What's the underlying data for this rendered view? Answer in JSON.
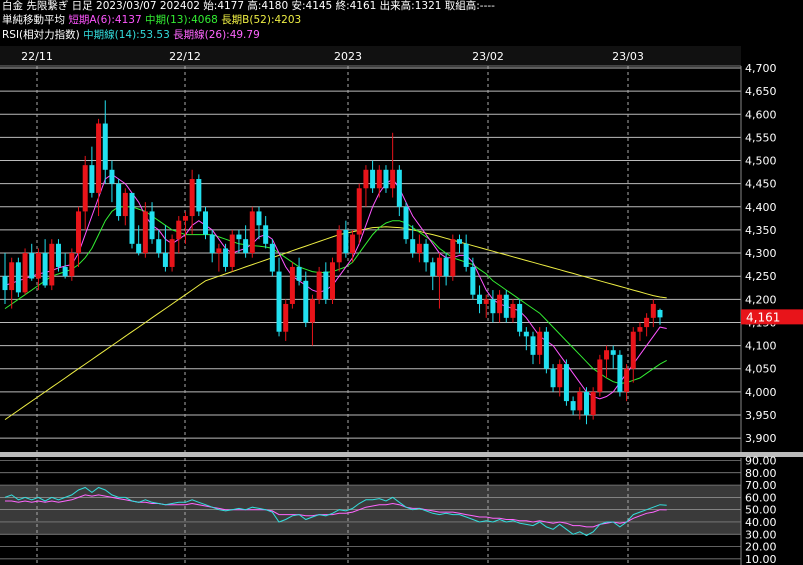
{
  "header": {
    "line1": "白金 先限繋ぎ 日足 2023/03/07 202402 始:4177 高:4180 安:4145 終:4161 出来高:1321 取組高:----",
    "ma_title": "単純移動平均",
    "ma_short": "短期A(6):4137",
    "ma_mid": "中期(13):4068",
    "ma_long": "長期B(52):4203",
    "rsi_title": "RSI(相対力指数)",
    "rsi_mid": "中期線(14):53.53",
    "rsi_long": "長期線(26):49.79"
  },
  "colors": {
    "up": "#e8141a",
    "down": "#22e0f0",
    "ma_short": "#ff55ff",
    "ma_mid": "#33ee33",
    "ma_long": "#eeee44",
    "rsi_mid": "#33dddd",
    "rsi_long": "#ff66ff",
    "price_tag": "#e8141a"
  },
  "chart_data": [
    {
      "type": "candlestick",
      "x_labels": [
        "22/11",
        "22/12",
        "2023",
        "23/02",
        "23/03"
      ],
      "y_ticks": [
        "4,700",
        "4,650",
        "4,600",
        "4,550",
        "4,500",
        "4,450",
        "4,400",
        "4,350",
        "4,300",
        "4,250",
        "4,200",
        "4,150",
        "4,100",
        "4,050",
        "4,000",
        "3,950",
        "3,900"
      ],
      "ylim": [
        3870,
        4700
      ],
      "last_price_label": "4,161",
      "last_price": 4161,
      "candles": [
        [
          4250,
          4300,
          4190,
          4220
        ],
        [
          4220,
          4290,
          4180,
          4280
        ],
        [
          4280,
          4290,
          4205,
          4215
        ],
        [
          4215,
          4310,
          4210,
          4300
        ],
        [
          4300,
          4320,
          4240,
          4245
        ],
        [
          4245,
          4310,
          4220,
          4300
        ],
        [
          4300,
          4330,
          4225,
          4230
        ],
        [
          4230,
          4330,
          4220,
          4320
        ],
        [
          4320,
          4330,
          4260,
          4270
        ],
        [
          4270,
          4300,
          4245,
          4250
        ],
        [
          4250,
          4310,
          4240,
          4300
        ],
        [
          4300,
          4400,
          4270,
          4390
        ],
        [
          4390,
          4510,
          4350,
          4490
        ],
        [
          4490,
          4530,
          4420,
          4430
        ],
        [
          4430,
          4590,
          4380,
          4580
        ],
        [
          4580,
          4630,
          4450,
          4480
        ],
        [
          4480,
          4500,
          4410,
          4450
        ],
        [
          4450,
          4460,
          4370,
          4380
        ],
        [
          4380,
          4440,
          4360,
          4430
        ],
        [
          4430,
          4430,
          4310,
          4320
        ],
        [
          4320,
          4360,
          4295,
          4300
        ],
        [
          4300,
          4410,
          4290,
          4390
        ],
        [
          4390,
          4410,
          4320,
          4330
        ],
        [
          4330,
          4350,
          4290,
          4300
        ],
        [
          4300,
          4360,
          4260,
          4270
        ],
        [
          4270,
          4340,
          4260,
          4330
        ],
        [
          4330,
          4380,
          4300,
          4370
        ],
        [
          4370,
          4390,
          4320,
          4380
        ],
        [
          4380,
          4480,
          4340,
          4460
        ],
        [
          4460,
          4470,
          4380,
          4390
        ],
        [
          4390,
          4400,
          4330,
          4340
        ],
        [
          4340,
          4350,
          4280,
          4300
        ],
        [
          4300,
          4320,
          4260,
          4310
        ],
        [
          4310,
          4320,
          4260,
          4270
        ],
        [
          4270,
          4350,
          4260,
          4340
        ],
        [
          4340,
          4350,
          4300,
          4330
        ],
        [
          4330,
          4360,
          4290,
          4300
        ],
        [
          4300,
          4400,
          4290,
          4390
        ],
        [
          4390,
          4400,
          4330,
          4360
        ],
        [
          4360,
          4380,
          4310,
          4320
        ],
        [
          4320,
          4330,
          4250,
          4260
        ],
        [
          4260,
          4290,
          4120,
          4130
        ],
        [
          4130,
          4200,
          4110,
          4190
        ],
        [
          4190,
          4280,
          4180,
          4270
        ],
        [
          4270,
          4290,
          4230,
          4240
        ],
        [
          4240,
          4260,
          4140,
          4150
        ],
        [
          4150,
          4210,
          4100,
          4200
        ],
        [
          4200,
          4270,
          4190,
          4260
        ],
        [
          4260,
          4280,
          4190,
          4200
        ],
        [
          4200,
          4290,
          4190,
          4280
        ],
        [
          4280,
          4360,
          4260,
          4350
        ],
        [
          4350,
          4370,
          4290,
          4300
        ],
        [
          4300,
          4350,
          4280,
          4340
        ],
        [
          4340,
          4450,
          4320,
          4440
        ],
        [
          4440,
          4490,
          4400,
          4480
        ],
        [
          4480,
          4500,
          4430,
          4440
        ],
        [
          4440,
          4490,
          4420,
          4480
        ],
        [
          4480,
          4490,
          4430,
          4440
        ],
        [
          4440,
          4560,
          4420,
          4480
        ],
        [
          4480,
          4490,
          4380,
          4400
        ],
        [
          4400,
          4410,
          4320,
          4330
        ],
        [
          4330,
          4360,
          4290,
          4300
        ],
        [
          4300,
          4340,
          4280,
          4320
        ],
        [
          4320,
          4330,
          4260,
          4280
        ],
        [
          4280,
          4290,
          4220,
          4250
        ],
        [
          4250,
          4300,
          4180,
          4290
        ],
        [
          4290,
          4300,
          4230,
          4250
        ],
        [
          4250,
          4340,
          4240,
          4330
        ],
        [
          4330,
          4340,
          4300,
          4320
        ],
        [
          4320,
          4340,
          4260,
          4270
        ],
        [
          4270,
          4290,
          4200,
          4210
        ],
        [
          4210,
          4230,
          4170,
          4190
        ],
        [
          4190,
          4210,
          4160,
          4200
        ],
        [
          4200,
          4220,
          4150,
          4170
        ],
        [
          4170,
          4220,
          4150,
          4210
        ],
        [
          4210,
          4220,
          4150,
          4160
        ],
        [
          4160,
          4200,
          4150,
          4190
        ],
        [
          4190,
          4200,
          4120,
          4130
        ],
        [
          4130,
          4140,
          4090,
          4120
        ],
        [
          4120,
          4130,
          4060,
          4080
        ],
        [
          4080,
          4140,
          4060,
          4130
        ],
        [
          4130,
          4140,
          4040,
          4050
        ],
        [
          4050,
          4060,
          4000,
          4010
        ],
        [
          4010,
          4070,
          3990,
          4060
        ],
        [
          4060,
          4070,
          3970,
          3980
        ],
        [
          3980,
          3990,
          3950,
          3960
        ],
        [
          3960,
          4010,
          3940,
          4000
        ],
        [
          4000,
          4010,
          3930,
          3950
        ],
        [
          3950,
          4010,
          3940,
          4000
        ],
        [
          4000,
          4080,
          3990,
          4070
        ],
        [
          4070,
          4100,
          4030,
          4090
        ],
        [
          4090,
          4100,
          4050,
          4080
        ],
        [
          4080,
          4090,
          3990,
          4000
        ],
        [
          4000,
          4060,
          3980,
          4050
        ],
        [
          4050,
          4140,
          4020,
          4130
        ],
        [
          4130,
          4150,
          4110,
          4140
        ],
        [
          4140,
          4170,
          4120,
          4160
        ],
        [
          4160,
          4200,
          4140,
          4190
        ],
        [
          4177,
          4180,
          4145,
          4161
        ]
      ],
      "ma_short": [
        4230,
        4235,
        4240,
        4245,
        4250,
        4255,
        4258,
        4262,
        4268,
        4272,
        4275,
        4300,
        4340,
        4380,
        4420,
        4460,
        4470,
        4460,
        4450,
        4430,
        4410,
        4380,
        4360,
        4350,
        4330,
        4320,
        4330,
        4340,
        4360,
        4370,
        4360,
        4350,
        4330,
        4310,
        4300,
        4305,
        4310,
        4320,
        4335,
        4340,
        4330,
        4300,
        4270,
        4250,
        4240,
        4230,
        4220,
        4215,
        4220,
        4230,
        4250,
        4270,
        4290,
        4320,
        4360,
        4400,
        4430,
        4450,
        4460,
        4440,
        4410,
        4380,
        4360,
        4340,
        4320,
        4300,
        4290,
        4290,
        4295,
        4295,
        4280,
        4250,
        4220,
        4200,
        4190,
        4185,
        4180,
        4175,
        4160,
        4140,
        4120,
        4110,
        4100,
        4080,
        4060,
        4040,
        4020,
        4000,
        3990,
        3985,
        3990,
        4000,
        4020,
        4040,
        4060,
        4080,
        4100,
        4120,
        4140,
        4137
      ],
      "ma_mid": [
        4180,
        4190,
        4200,
        4210,
        4220,
        4230,
        4240,
        4250,
        4255,
        4260,
        4265,
        4275,
        4290,
        4310,
        4340,
        4370,
        4390,
        4400,
        4400,
        4400,
        4395,
        4390,
        4380,
        4370,
        4360,
        4350,
        4345,
        4340,
        4340,
        4340,
        4340,
        4340,
        4335,
        4330,
        4325,
        4320,
        4318,
        4316,
        4315,
        4313,
        4310,
        4300,
        4290,
        4280,
        4270,
        4265,
        4260,
        4258,
        4258,
        4260,
        4265,
        4270,
        4280,
        4300,
        4320,
        4340,
        4355,
        4365,
        4370,
        4370,
        4365,
        4355,
        4345,
        4335,
        4325,
        4310,
        4300,
        4290,
        4285,
        4280,
        4275,
        4265,
        4255,
        4240,
        4230,
        4220,
        4210,
        4200,
        4190,
        4180,
        4170,
        4155,
        4140,
        4125,
        4110,
        4095,
        4080,
        4065,
        4050,
        4040,
        4030,
        4022,
        4018,
        4020,
        4025,
        4030,
        4040,
        4050,
        4060,
        4068
      ],
      "ma_long": [
        3940,
        3950,
        3960,
        3970,
        3980,
        3990,
        4000,
        4010,
        4020,
        4030,
        4040,
        4050,
        4060,
        4070,
        4080,
        4090,
        4100,
        4110,
        4120,
        4130,
        4140,
        4150,
        4160,
        4170,
        4180,
        4190,
        4200,
        4210,
        4220,
        4230,
        4240,
        4245,
        4250,
        4255,
        4260,
        4265,
        4270,
        4275,
        4280,
        4285,
        4290,
        4295,
        4300,
        4305,
        4310,
        4315,
        4320,
        4325,
        4330,
        4335,
        4340,
        4343,
        4346,
        4349,
        4352,
        4355,
        4356,
        4357,
        4356,
        4355,
        4353,
        4350,
        4347,
        4343,
        4340,
        4336,
        4332,
        4328,
        4324,
        4320,
        4316,
        4312,
        4308,
        4304,
        4300,
        4296,
        4292,
        4288,
        4284,
        4280,
        4276,
        4272,
        4268,
        4264,
        4260,
        4256,
        4252,
        4248,
        4244,
        4240,
        4236,
        4232,
        4228,
        4224,
        4220,
        4216,
        4212,
        4208,
        4205,
        4203
      ]
    },
    {
      "type": "line",
      "y_ticks": [
        "90.00",
        "80.00",
        "70.00",
        "60.00",
        "50.00",
        "40.00",
        "30.00",
        "20.00",
        "10.00"
      ],
      "ylim": [
        5,
        92
      ],
      "band": [
        30,
        70
      ],
      "series": [
        {
          "name": "中期線(14)",
          "values": [
            60,
            62,
            58,
            60,
            58,
            60,
            57,
            60,
            58,
            60,
            62,
            66,
            68,
            64,
            68,
            66,
            62,
            60,
            60,
            57,
            56,
            58,
            56,
            55,
            54,
            55,
            56,
            56,
            58,
            56,
            54,
            52,
            50,
            49,
            50,
            51,
            50,
            52,
            51,
            50,
            48,
            40,
            42,
            45,
            46,
            42,
            44,
            46,
            45,
            47,
            50,
            49,
            51,
            55,
            58,
            58,
            59,
            57,
            60,
            56,
            52,
            50,
            51,
            49,
            47,
            46,
            47,
            46,
            46,
            44,
            42,
            40,
            41,
            40,
            42,
            40,
            41,
            39,
            38,
            37,
            40,
            36,
            34,
            38,
            34,
            30,
            32,
            29,
            32,
            38,
            40,
            40,
            36,
            40,
            46,
            48,
            50,
            52,
            54,
            53.53
          ]
        },
        {
          "name": "長期線(26)",
          "values": [
            57,
            57,
            56,
            57,
            56,
            57,
            56,
            57,
            56,
            57,
            58,
            60,
            62,
            61,
            62,
            61,
            60,
            59,
            58,
            57,
            56,
            56,
            55,
            55,
            54,
            54,
            54,
            54,
            55,
            54,
            53,
            52,
            51,
            50,
            50,
            50,
            50,
            50,
            50,
            50,
            49,
            46,
            46,
            46,
            46,
            45,
            45,
            46,
            46,
            46,
            47,
            47,
            48,
            50,
            52,
            53,
            54,
            54,
            55,
            54,
            52,
            51,
            51,
            50,
            49,
            48,
            48,
            48,
            47,
            46,
            45,
            44,
            44,
            43,
            43,
            42,
            42,
            41,
            41,
            40,
            41,
            40,
            39,
            40,
            39,
            37,
            37,
            36,
            36,
            38,
            39,
            40,
            39,
            40,
            43,
            45,
            47,
            48,
            50,
            49.79
          ]
        }
      ]
    }
  ]
}
